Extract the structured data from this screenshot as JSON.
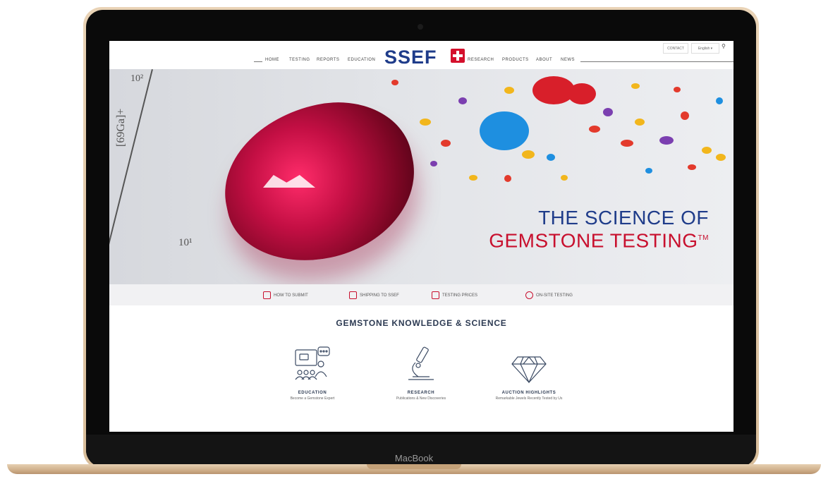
{
  "device": {
    "label": "MacBook"
  },
  "nav": {
    "left_items": [
      "HOME",
      "TESTING",
      "REPORTS",
      "EDUCATION"
    ],
    "logo": "SSEF",
    "right_items": [
      "RESEARCH",
      "PRODUCTS",
      "ABOUT",
      "NEWS"
    ],
    "contact": "CONTACT",
    "language": "English ▾",
    "search_icon": "search-icon"
  },
  "hero": {
    "axis_label": "[69Ga]+",
    "tick_top": "10²",
    "tick_bottom": "10¹",
    "title_line1": "THE SCIENCE OF",
    "title_line2": "GEMSTONE TESTING",
    "trademark": "TM"
  },
  "quicklinks": [
    {
      "label": "HOW TO SUBMIT",
      "icon": "box-icon"
    },
    {
      "label": "SHIPPING TO SSEF",
      "icon": "plane-icon"
    },
    {
      "label": "TESTING PRICES",
      "icon": "document-icon"
    },
    {
      "label": "ON-SITE TESTING",
      "icon": "globe-icon"
    }
  ],
  "knowledge": {
    "title": "GEMSTONE KNOWLEDGE & SCIENCE",
    "cards": [
      {
        "title": "EDUCATION",
        "subtitle": "Become a Gemstone Expert",
        "icon": "presentation-icon"
      },
      {
        "title": "RESEARCH",
        "subtitle": "Publications & New Discoveries",
        "icon": "microscope-icon"
      },
      {
        "title": "AUCTION HIGHLIGHTS",
        "subtitle": "Remarkable Jewels Recently Tested by Us",
        "icon": "diamond-icon"
      }
    ]
  },
  "colors": {
    "brand_blue": "#1f3c8a",
    "brand_red": "#c8102e"
  }
}
